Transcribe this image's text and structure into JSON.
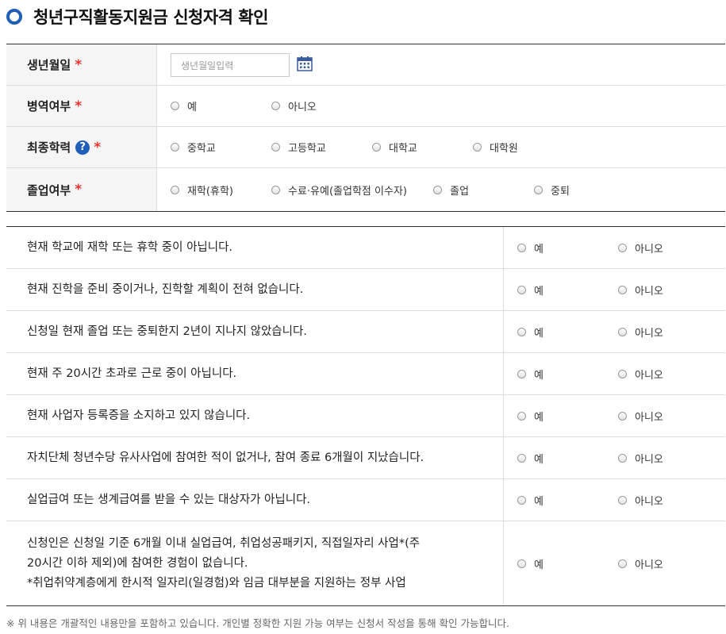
{
  "page": {
    "title": "청년구직활동지원금 신청자격 확인"
  },
  "basic_form": {
    "required_mark": "*",
    "birth": {
      "label": "생년월일",
      "placeholder": "생년월일입력",
      "calendar_icon": "calendar-icon"
    },
    "military": {
      "label": "병역여부",
      "options": [
        "예",
        "아니오"
      ]
    },
    "education": {
      "label": "최종학력",
      "help_icon": "?",
      "options": [
        "중학교",
        "고등학교",
        "대학교",
        "대학원"
      ]
    },
    "graduation": {
      "label": "졸업여부",
      "options": [
        "재학(휴학)",
        "수료·유예(졸업학점 이수자)",
        "졸업",
        "중퇴"
      ]
    }
  },
  "questions": {
    "yes_label": "예",
    "no_label": "아니오",
    "items": [
      {
        "text": "현재 학교에 재학 또는 휴학 중이 아닙니다."
      },
      {
        "text": "현재 진학을 준비 중이거나, 진학할 계획이 전혀 없습니다."
      },
      {
        "text": "신청일 현재 졸업 또는 중퇴한지 2년이 지나지 않았습니다."
      },
      {
        "text": "현재 주 20시간 초과로 근로 중이 아닙니다."
      },
      {
        "text": "현재 사업자 등록증을 소지하고 있지 않습니다."
      },
      {
        "text": "자치단체 청년수당 유사사업에 참여한 적이 없거나, 참여 종료 6개월이 지났습니다."
      },
      {
        "text": "실업급여 또는 생계급여를 받을 수 있는 대상자가 아닙니다."
      },
      {
        "text_line1": "신청인은 신청일 기준 6개월 이내 실업급여, 취업성공패키지, 직접일자리 사업*(주",
        "text_line2": "20시간 이하 제외)에 참여한 경험이 없습니다.",
        "text_line3": "*취업취약계층에게 한시적 일자리(일경험)와 임금 대부분을 지원하는 정부 사업"
      }
    ]
  },
  "footnote": "※ 위 내용은 개괄적인 내용만을 포함하고 있습니다. 개인별 정확한 지원 가능 여부는 신청서 작성을 통해 확인 가능합니다.",
  "colors": {
    "accent": "#1f5fb8",
    "required": "#e5322d"
  }
}
